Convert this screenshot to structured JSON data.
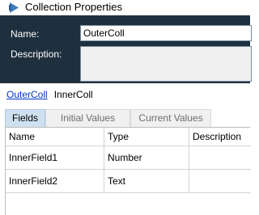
{
  "window": {
    "title": "Collection Properties",
    "icon": "collection-icon"
  },
  "form": {
    "name_label": "Name:",
    "name_value": "OuterColl",
    "description_label": "Description:",
    "description_value": ""
  },
  "breadcrumb": {
    "parent": "OuterColl",
    "current": "InnerColl"
  },
  "tabs": [
    "Fields",
    "Initial Values",
    "Current Values"
  ],
  "active_tab": "Fields",
  "fields_table": {
    "columns": [
      "Name",
      "Type",
      "Description"
    ],
    "rows": [
      {
        "name": "InnerField1",
        "type": "Number",
        "description": ""
      },
      {
        "name": "InnerField2",
        "type": "Text",
        "description": ""
      }
    ]
  }
}
